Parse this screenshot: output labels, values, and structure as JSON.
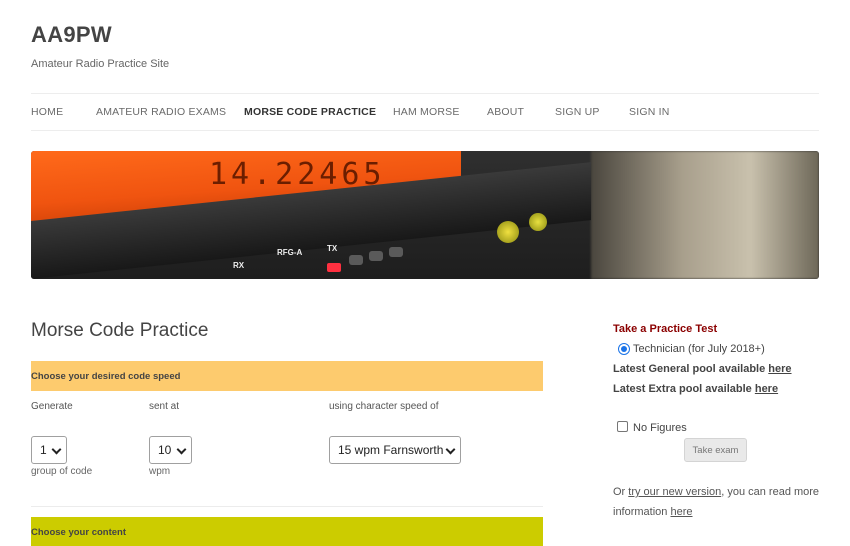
{
  "site": {
    "title": "AA9PW",
    "description": "Amateur Radio Practice Site"
  },
  "nav": {
    "items": [
      {
        "label": "HOME"
      },
      {
        "label": "AMATEUR RADIO EXAMS"
      },
      {
        "label": "MORSE CODE PRACTICE"
      },
      {
        "label": "HAM MORSE"
      },
      {
        "label": "ABOUT"
      },
      {
        "label": "SIGN UP"
      },
      {
        "label": "SIGN IN"
      }
    ],
    "active": "MORSE CODE PRACTICE"
  },
  "banner": {
    "digits": "14.22465",
    "labels": [
      "RX",
      "RFG-A",
      "TX"
    ]
  },
  "main": {
    "title": "Morse Code Practice",
    "speed_section": "Choose your desired code speed",
    "generate_label": "Generate",
    "sent_at_label": "sent at",
    "char_speed_label": "using character speed of",
    "group_select_value": "1",
    "wpm_select_value": "10",
    "char_speed_select_value": "15 wpm Farnsworth",
    "group_of_code_label": "group of code",
    "wpm_label": "wpm",
    "content_section": "Choose your content"
  },
  "sidebar": {
    "title": "Take a Practice Test",
    "radio_label": "Technician (for July 2018+)",
    "general_text": "Latest General pool available ",
    "general_link": "here",
    "extra_text": "Latest Extra pool available ",
    "extra_link": "here",
    "no_figures_label": "No Figures",
    "take_exam_button": "Take exam",
    "info_prefix": "Or ",
    "info_link1": "try our new version",
    "info_mid": ", you can read more information ",
    "info_link2": "here"
  },
  "colors": {
    "speed_bar": "#fdcb6e",
    "content_bar": "#cccc00",
    "sidebar_title": "#8b0000",
    "radio_accent": "#1a73e8"
  }
}
